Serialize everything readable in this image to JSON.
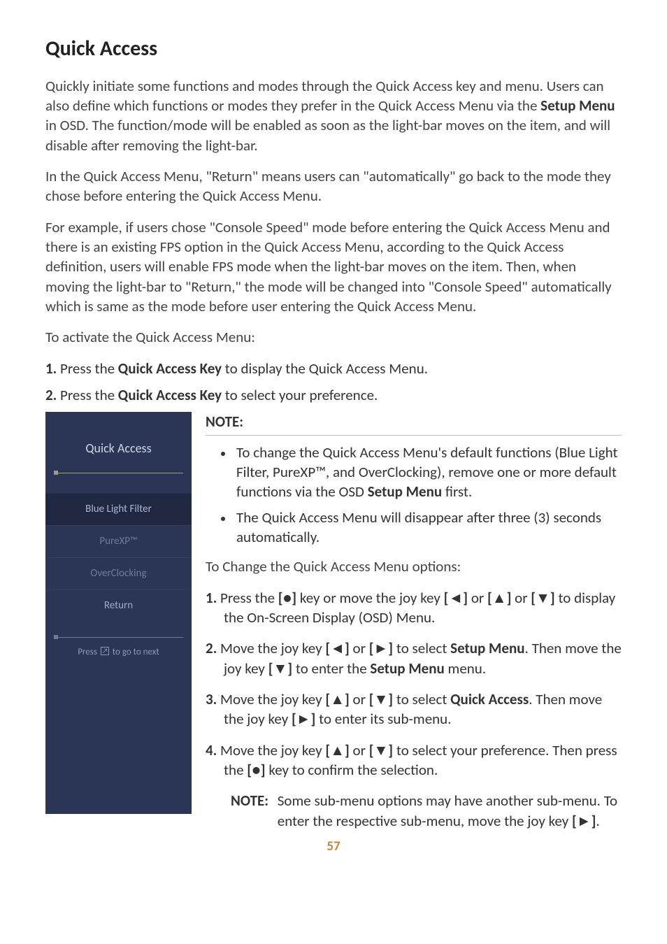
{
  "title": "Quick Access",
  "intro": {
    "p1_a": "Quickly initiate some functions and modes through the Quick Access key and menu. Users can also define which functions or modes they prefer in the Quick Access Menu via the ",
    "p1_b": "Setup Menu",
    "p1_c": " in OSD. The function/mode will be enabled as soon as the light-bar moves on the item, and will disable after removing the light-bar.",
    "p2": "In the Quick Access Menu, \"Return\" means users can \"automatically\" go back to the mode they chose before entering the Quick Access Menu.",
    "p3": "For example, if users chose \"Console Speed\" mode before entering the Quick Access Menu and there is an existing FPS option in the Quick Access Menu, according to the Quick Access definition, users will enable FPS mode when the light-bar moves on the item. Then, when moving the light-bar to \"Return,\" the mode will be changed into \"Console Speed\" automatically which is same as the mode before user entering the Quick Access Menu.",
    "p4": "To activate the Quick Access Menu:"
  },
  "topSteps": {
    "s1": {
      "num": "1.",
      "a": " Press the ",
      "b": "Quick Access Key",
      "c": " to display the Quick Access Menu."
    },
    "s2": {
      "num": "2.",
      "a": " Press the ",
      "b": "Quick Access Key",
      "c": " to select your preference."
    }
  },
  "panel": {
    "title": "Quick Access",
    "items": [
      "Blue Light Filter",
      "PureXP™",
      "OverClocking",
      "Return"
    ],
    "hint_a": "Press ",
    "hint_b": " to go to next"
  },
  "note": {
    "heading": "NOTE:",
    "b1_a": "To change the Quick Access Menu's default functions (Blue Light Filter, PureXP™, and OverClocking), remove one or more default functions via the OSD ",
    "b1_b": "Setup Menu",
    "b1_c": " first.",
    "b2": "The Quick Access Menu will disappear after three (3) seconds automatically."
  },
  "changeIntro": "To Change the Quick Access Menu options:",
  "steps": {
    "s1": {
      "n": "1.",
      "a": " Press the ",
      "k1": "[●]",
      "b": " key or move the joy key ",
      "k2": "[◄]",
      "c": " or ",
      "k3": "[▲]",
      "d": " or ",
      "k4": "[▼]",
      "e": " to display the On-Screen Display (OSD) Menu."
    },
    "s2": {
      "n": "2.",
      "a": " Move the joy key ",
      "k1": "[◄]",
      "b": " or ",
      "k2": "[►]",
      "c": " to select ",
      "bold1": "Setup Menu",
      "d": ". Then move the joy key ",
      "k3": "[▼]",
      "e": " to enter the ",
      "bold2": "Setup Menu",
      "f": " menu."
    },
    "s3": {
      "n": "3.",
      "a": " Move the joy key ",
      "k1": "[▲]",
      "b": " or ",
      "k2": "[▼]",
      "c": " to select ",
      "bold1": "Quick Access",
      "d": ". Then move the joy key ",
      "k3": "[►]",
      "e": " to enter its sub-menu."
    },
    "s4": {
      "n": "4.",
      "a": " Move the joy key ",
      "k1": "[▲]",
      "b": " or ",
      "k2": "[▼]",
      "c": " to select your preference. Then press the ",
      "k3": "[●]",
      "d": " key to confirm the selection."
    },
    "subnote": {
      "label": "NOTE:",
      "text_a": "Some sub-menu options may have another sub-menu. To enter the respective sub-menu, move the joy key ",
      "k": "[►]",
      "text_b": "."
    }
  },
  "page": "57"
}
